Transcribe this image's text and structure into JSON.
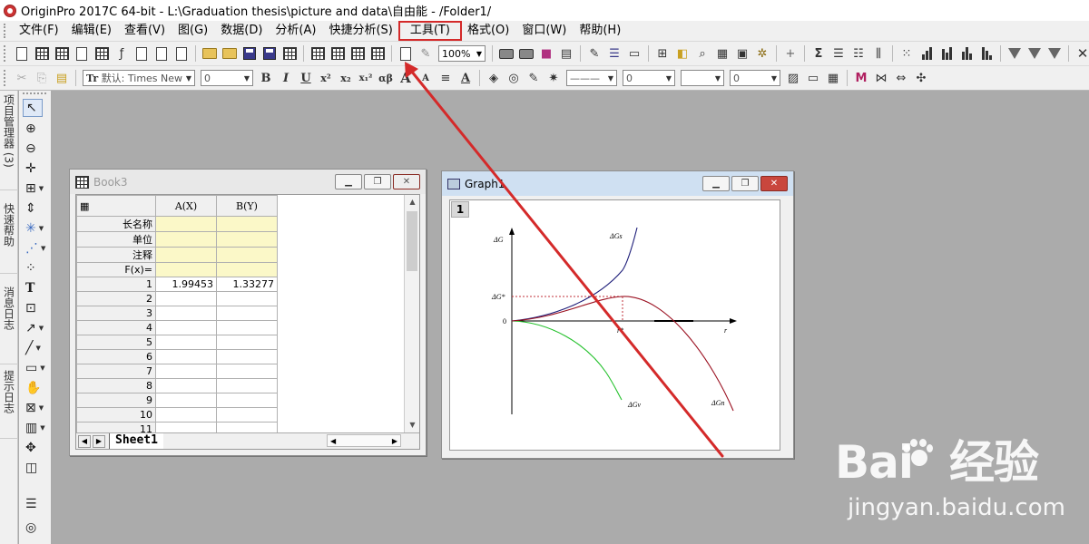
{
  "app": {
    "title": "OriginPro 2017C 64-bit - L:\\Graduation thesis\\picture and data\\自由能 - /Folder1/"
  },
  "menu": [
    {
      "label": "文件(F)"
    },
    {
      "label": "编辑(E)"
    },
    {
      "label": "查看(V)"
    },
    {
      "label": "图(G)"
    },
    {
      "label": "数据(D)"
    },
    {
      "label": "分析(A)"
    },
    {
      "label": "快捷分析(S)"
    },
    {
      "label": "工具(T)",
      "highlighted": true
    },
    {
      "label": "格式(O)"
    },
    {
      "label": "窗口(W)"
    },
    {
      "label": "帮助(H)"
    }
  ],
  "toolbar": {
    "zoom": "100%"
  },
  "format_toolbar": {
    "font_prefix": "Tr",
    "font_name": "默认: Times New",
    "font_size": "0",
    "bold": "B",
    "italic": "I",
    "underline": "U",
    "superscript": "x²",
    "subscript": "x₂",
    "supsub": "x₁²",
    "greek": "αβ",
    "grow": "A",
    "shrink": "A",
    "font_color": "A",
    "line_style": "———",
    "line_width": "0",
    "fill": "0"
  },
  "side_tabs": [
    "项目管理器 (3)",
    "快速帮助",
    "消息日志",
    "提示日志"
  ],
  "book": {
    "title": "Book3",
    "columns": [
      "A(X)",
      "B(Y)"
    ],
    "meta_rows": [
      "长名称",
      "单位",
      "注释",
      "F(x)="
    ],
    "rows": [
      {
        "n": "1",
        "a": "1.99453",
        "b": "1.33277"
      },
      {
        "n": "2",
        "a": "",
        "b": ""
      },
      {
        "n": "3",
        "a": "",
        "b": ""
      },
      {
        "n": "4",
        "a": "",
        "b": ""
      },
      {
        "n": "5",
        "a": "",
        "b": ""
      },
      {
        "n": "6",
        "a": "",
        "b": ""
      },
      {
        "n": "7",
        "a": "",
        "b": ""
      },
      {
        "n": "8",
        "a": "",
        "b": ""
      },
      {
        "n": "9",
        "a": "",
        "b": ""
      },
      {
        "n": "10",
        "a": "",
        "b": ""
      },
      {
        "n": "11",
        "a": "",
        "b": ""
      }
    ],
    "sheet_tab": "Sheet1"
  },
  "graph": {
    "title": "Graph1",
    "layer": "1",
    "labels": {
      "y_axis": "ΔG",
      "dg_star": "ΔG*",
      "zero": "0",
      "r_star": "r*",
      "r_axis": "r",
      "dg_s": "ΔGs",
      "dg_v": "ΔGv",
      "dg_n": "ΔGn"
    },
    "colors": {
      "dg_s": "#1f1f7a",
      "dg_v": "#22c02a",
      "dg_n": "#9a1020",
      "dashed": "#c0303a"
    }
  },
  "annotation": {
    "arrow_color": "#d42a2a"
  },
  "watermark": {
    "logo_left": "Bai",
    "logo_right": "经验",
    "url": "jingyan.baidu.com"
  }
}
